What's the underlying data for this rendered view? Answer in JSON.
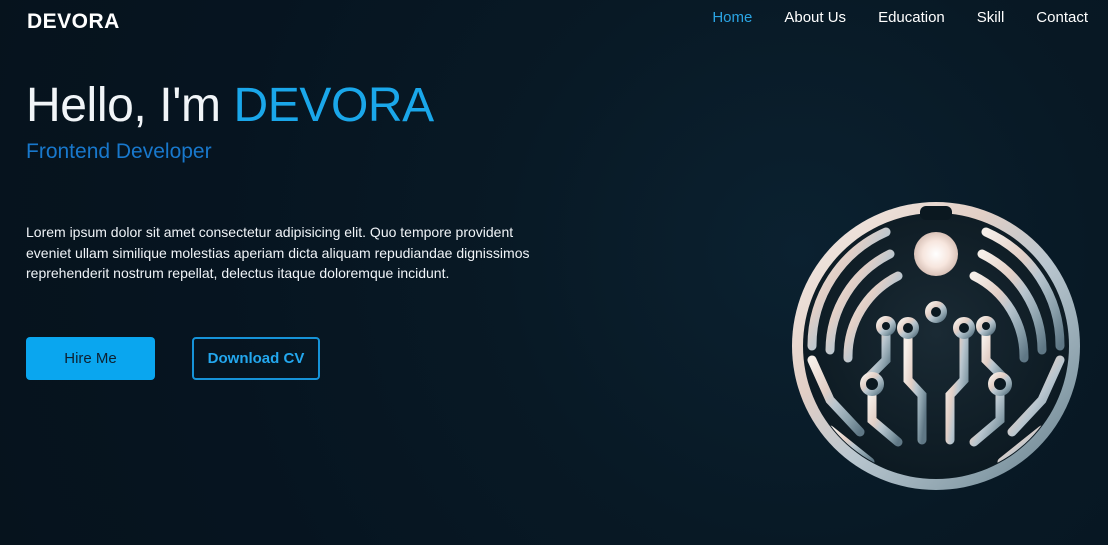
{
  "brand": {
    "logo_text": "DEVORA"
  },
  "nav": {
    "items": [
      {
        "label": "Home",
        "active": true
      },
      {
        "label": "About Us",
        "active": false
      },
      {
        "label": "Education",
        "active": false
      },
      {
        "label": "Skill",
        "active": false
      },
      {
        "label": "Contact",
        "active": false
      }
    ]
  },
  "hero": {
    "greeting": "Hello, I'm ",
    "name": "DEVORA",
    "subtitle": "Frontend Developer",
    "description": "Lorem ipsum dolor sit amet consectetur adipisicing elit. Quo tempore provident eveniet ullam similique molestias aperiam dicta aliquam repudiandae dignissimos reprehenderit nostrum repellat, delectus itaque doloremque incidunt.",
    "primary_button": "Hire Me",
    "secondary_button": "Download CV"
  },
  "emblem": {
    "icon": "circuit-tree-logo-icon"
  },
  "colors": {
    "background": "#071623",
    "accent": "#1aa7ea",
    "subtitle": "#1878cc",
    "button_primary": "#0aa6ef"
  }
}
